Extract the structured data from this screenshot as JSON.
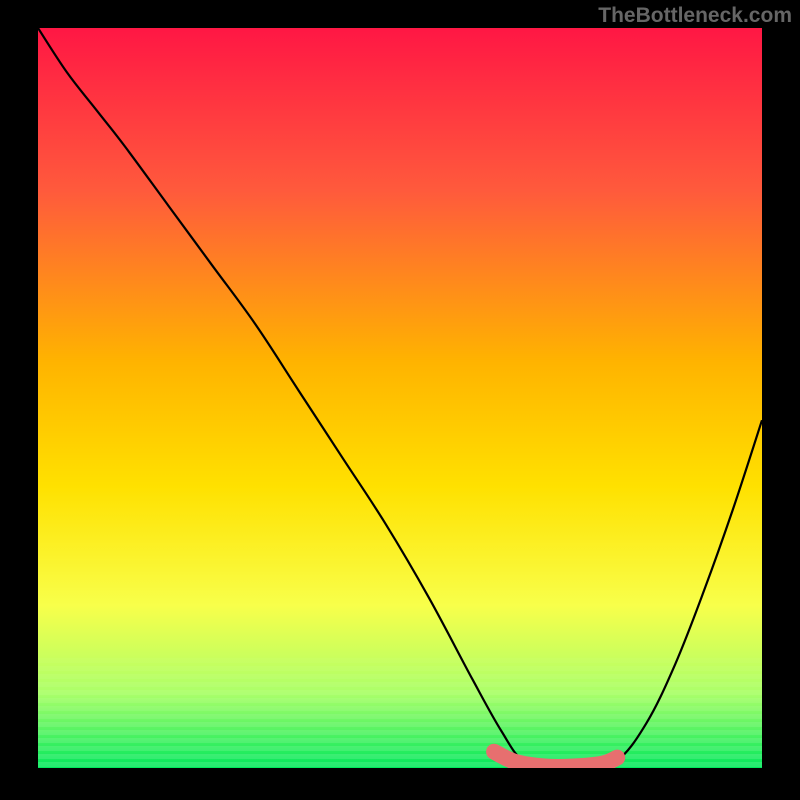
{
  "watermark": "TheBottleneck.com",
  "chart_data": {
    "type": "line",
    "title": "",
    "xlabel": "",
    "ylabel": "",
    "xlim": [
      0,
      100
    ],
    "ylim": [
      0,
      100
    ],
    "background_gradient": {
      "stops": [
        {
          "offset": 0.0,
          "color": "#ff1744"
        },
        {
          "offset": 0.22,
          "color": "#ff5a3c"
        },
        {
          "offset": 0.45,
          "color": "#ffb300"
        },
        {
          "offset": 0.62,
          "color": "#ffe100"
        },
        {
          "offset": 0.78,
          "color": "#f8ff4a"
        },
        {
          "offset": 0.9,
          "color": "#aaff6a"
        },
        {
          "offset": 1.0,
          "color": "#00e85b"
        }
      ]
    },
    "series": [
      {
        "name": "bottleneck-curve",
        "color": "#000000",
        "x": [
          0,
          4,
          8,
          12,
          18,
          24,
          30,
          36,
          42,
          48,
          54,
          60,
          64,
          67,
          71,
          76,
          80,
          84,
          88,
          92,
          96,
          100
        ],
        "y": [
          100,
          94,
          89,
          84,
          76,
          68,
          60,
          51,
          42,
          33,
          23,
          12,
          5,
          1,
          0,
          0,
          1,
          6,
          14,
          24,
          35,
          47
        ]
      }
    ],
    "highlight_segment": {
      "name": "optimal-range",
      "color": "#e76f6f",
      "x": [
        63,
        66,
        70,
        74,
        78,
        80
      ],
      "y": [
        2.2,
        0.8,
        0.2,
        0.2,
        0.6,
        1.4
      ]
    }
  }
}
